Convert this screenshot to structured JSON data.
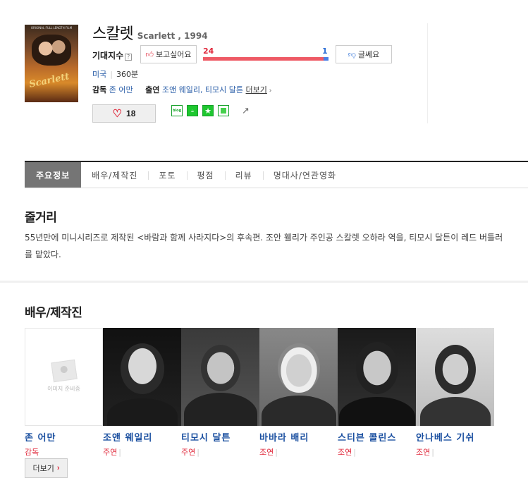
{
  "movie": {
    "title_ko": "스칼렛",
    "title_en": "Scarlett , 1994",
    "poster_text": "Scarlett",
    "poster_top_text": "ORIGINAL FULL LENGTH FILM"
  },
  "expectation": {
    "label": "기대지수",
    "help": "?",
    "want_label": "보고싶어요",
    "no_label": "글쎄요",
    "want_count": "24",
    "no_count": "1",
    "want_fraction": 0.96
  },
  "meta": {
    "country": "미국",
    "runtime": "360분"
  },
  "people": {
    "director_label": "감독",
    "director": "존 어만",
    "cast_label": "출연",
    "cast": "조앤 웨일리, 티모시 달튼",
    "more": "더보기"
  },
  "like": {
    "count": "18"
  },
  "share": {
    "blog_label": "blog"
  },
  "tabs": [
    {
      "label": "주요정보"
    },
    {
      "label": "배우/제작진"
    },
    {
      "label": "포토"
    },
    {
      "label": "평점"
    },
    {
      "label": "리뷰"
    },
    {
      "label": "명대사/연관영화"
    }
  ],
  "synopsis": {
    "title": "줄거리",
    "text": "55년만에 미니시리즈로 제작된 <바람과 함께 사라지다>의 후속편. 조안 휄리가 주인공 스칼렛 오하라 역을, 티모시 달튼이 레드 버틀러를 맡았다."
  },
  "cast_section": {
    "title": "배우/제작진",
    "no_image_text": "이미지 준비중",
    "more": "더보기",
    "members": [
      {
        "name": "존 어만",
        "role": "감독"
      },
      {
        "name": "조앤 웨일리",
        "role": "주연"
      },
      {
        "name": "티모시 달튼",
        "role": "주연"
      },
      {
        "name": "바바라 배리",
        "role": "조연"
      },
      {
        "name": "스티븐 콜린스",
        "role": "조연"
      },
      {
        "name": "안나베스 기쉬",
        "role": "조연"
      }
    ]
  },
  "colors": {
    "like_red": "#e0293c",
    "dislike_blue": "#2a6dd6",
    "link_blue": "#1a4fa0",
    "active_tab": "#757575"
  }
}
